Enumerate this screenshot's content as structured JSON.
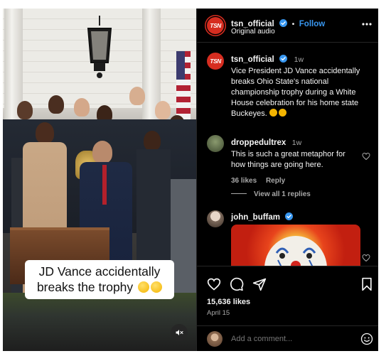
{
  "post": {
    "caption_overlay": "JD Vance accidentally breaks the trophy",
    "caption_emoji": [
      "face-with-hand-over-mouth",
      "flushed-face"
    ],
    "media_controls": {
      "mute_icon": "speaker-muted-icon"
    }
  },
  "header": {
    "username": "tsn_official",
    "separator": "•",
    "follow_label": "Follow",
    "audio_label": "Original audio",
    "avatar_text": "TSN",
    "menu_icon": "more-icon"
  },
  "caption": {
    "username": "tsn_official",
    "time": "1w",
    "text": "Vice President JD Vance accidentally breaks Ohio State's national championship trophy during a White House celebration for his home state Buckeyes."
  },
  "comments": [
    {
      "username": "droppedultrex",
      "time": "1w",
      "text": "This is such a great metaphor for how things are going here.",
      "likes": "36 likes",
      "reply_label": "Reply",
      "view_replies": "View all 1 replies"
    },
    {
      "username": "john_buffam",
      "image": "clown-face-gif"
    }
  ],
  "actions": {
    "likes": "15,636 likes",
    "date": "April 15"
  },
  "add_comment": {
    "placeholder": "Add a comment..."
  },
  "colors": {
    "background": "#000000",
    "accent_blue": "#3897f0",
    "tsn_red": "#d62d20",
    "text_secondary": "#a8a8a8"
  }
}
